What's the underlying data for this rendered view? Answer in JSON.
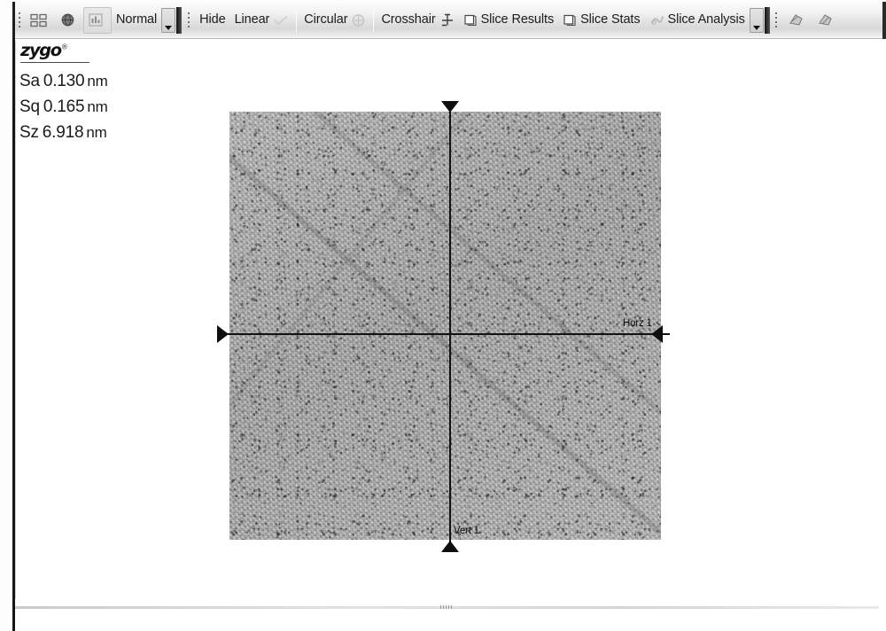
{
  "toolbar": {
    "groups": [
      {
        "name": "view-group",
        "items": [
          {
            "type": "icon",
            "icon": "tile-windows-icon",
            "label": ""
          },
          {
            "type": "icon",
            "icon": "globe-icon",
            "label": ""
          },
          {
            "type": "icon",
            "icon": "bar-chart-icon",
            "label": ""
          },
          {
            "type": "label",
            "icon": "",
            "label": "Normal"
          },
          {
            "type": "dropdown",
            "icon": "chevron-down-icon",
            "label": ""
          }
        ]
      },
      {
        "name": "slice-group",
        "items": [
          {
            "type": "label",
            "icon": "",
            "label": "Hide"
          },
          {
            "type": "label",
            "icon": "linear-slice-icon",
            "label": "Linear"
          },
          {
            "type": "label",
            "icon": "circular-slice-icon",
            "label": "Circular"
          },
          {
            "type": "label",
            "icon": "crosshair-icon",
            "label": "Crosshair"
          },
          {
            "type": "label",
            "icon": "slice-results-icon",
            "label": "Slice Results"
          },
          {
            "type": "label",
            "icon": "slice-stats-icon",
            "label": "Slice Stats"
          },
          {
            "type": "label",
            "icon": "slice-analysis-icon",
            "label": "Slice Analysis"
          },
          {
            "type": "dropdown",
            "icon": "chevron-down-icon",
            "label": ""
          }
        ]
      },
      {
        "name": "analysis-group",
        "items": [
          {
            "type": "icon",
            "icon": "surface-map-icon",
            "label": ""
          },
          {
            "type": "icon",
            "icon": "surface-map-alt-icon",
            "label": ""
          }
        ]
      }
    ]
  },
  "branding": {
    "logo_text": "zygo",
    "logo_mark": "®"
  },
  "statistics": [
    {
      "label": "Sa",
      "value": "0.130",
      "unit": "nm"
    },
    {
      "label": "Sq",
      "value": "0.165",
      "unit": "nm"
    },
    {
      "label": "Sz",
      "value": "6.918",
      "unit": "nm"
    }
  ],
  "surface_map": {
    "horizontal_slice_label": "Horz 1",
    "vertical_slice_label": "Vert 1"
  },
  "colors": {
    "toolbar_text": "#1c1c1c",
    "crosshair": "#121212",
    "surface_base": "#b0b0b0"
  }
}
